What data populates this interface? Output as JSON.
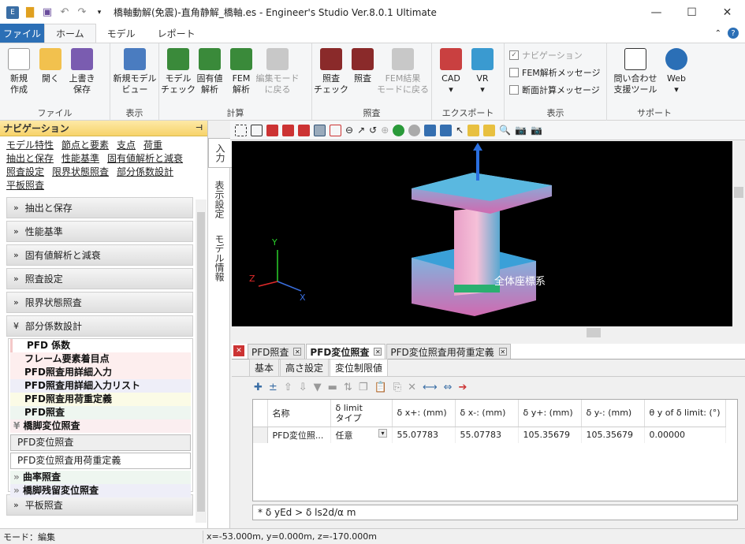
{
  "window": {
    "title": "橋軸動解(免震)-直角静解_橋軸.es - Engineer's Studio Ver.8.0.1 Ultimate"
  },
  "menu": {
    "file": "ファイル",
    "tabs": [
      "ホーム",
      "モデル",
      "レポート"
    ]
  },
  "ribbon": {
    "file": {
      "new": "新規\n作成",
      "open": "開く",
      "save": "上書き\n保存",
      "label": "ファイル"
    },
    "view": {
      "newview": "新規モデル\nビュー",
      "label": "表示"
    },
    "calc": {
      "check": "モデル\nチェック",
      "eigen": "固有値\n解析",
      "fem": "FEM\n解析",
      "back": "編集モード\nに戻る",
      "label": "計算"
    },
    "verify": {
      "check": "照査\nチェック",
      "verify": "照査",
      "femres": "FEM結果\nモードに戻る",
      "label": "照査"
    },
    "export": {
      "cad": "CAD",
      "vr": "VR",
      "label": "エクスポート"
    },
    "display": {
      "nav": "ナビゲーション",
      "femmsg": "FEM解析メッセージ",
      "secmsg": "断面計算メッセージ",
      "label": "表示"
    },
    "support": {
      "contact": "問い合わせ\n支援ツール",
      "web": "Web",
      "label": "サポート"
    }
  },
  "nav": {
    "title": "ナビゲーション",
    "links": [
      "モデル特性",
      "節点と要素",
      "支点",
      "荷重",
      "抽出と保存",
      "性能基準",
      "固有値解析と減衰",
      "照査設定",
      "限界状態照査",
      "部分係数設計",
      "平板照査"
    ],
    "sections": [
      "抽出と保存",
      "性能基準",
      "固有値解析と減衰",
      "照査設定",
      "限界状態照査",
      "部分係数設計"
    ],
    "sublist": [
      "PFD 係数",
      "フレーム要素着目点",
      "PFD照査用詳細入力",
      "PFD照査用詳細入力リスト",
      "PFD照査用荷重定義",
      "PFD照査",
      "橋脚変位照査",
      "PFD変位照査",
      "PFD変位照査用荷重定義",
      "曲率照査",
      "橋脚残留変位照査"
    ],
    "last": "平板照査",
    "vtabs": [
      "入力",
      "表示設定",
      "モデル情報"
    ]
  },
  "view3d": {
    "label": "全体座標系",
    "axis_x": "X",
    "axis_y": "Y",
    "axis_z": "Z"
  },
  "doc_tabs": [
    "PFD照査",
    "PFD変位照査",
    "PFD変位照査用荷重定義"
  ],
  "sub_tabs": [
    "基本",
    "高さ設定",
    "変位制限値"
  ],
  "grid": {
    "headers": [
      "名称",
      "δ limit\nタイプ",
      "δ x+: (mm)",
      "δ x-: (mm)",
      "δ y+: (mm)",
      "δ y-: (mm)",
      "θ y of δ limit: (°)"
    ],
    "rows": [
      [
        "PFD変位照...",
        "任意",
        "55.07783",
        "55.07783",
        "105.35679",
        "105.35679",
        "0.00000"
      ]
    ]
  },
  "formula": "* δ yEd > δ ls2d/α m",
  "status": {
    "mode": "モード：編集",
    "coords": "x=-53.000m, y=0.000m, z=-170.000m"
  }
}
